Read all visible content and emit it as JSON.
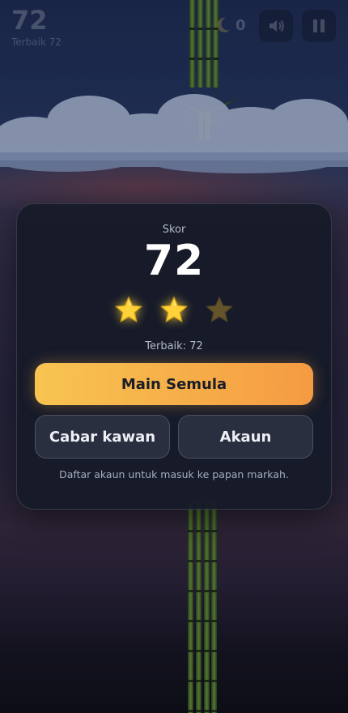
{
  "hud": {
    "score": "72",
    "best": "Terbaik 72",
    "moon_count": "0",
    "icons": [
      "moon-icon",
      "sound-icon",
      "pause-icon"
    ]
  },
  "result": {
    "score_label": "Skor",
    "score_value": "72",
    "stars_earned": 2,
    "stars_total": 3,
    "best_line": "Terbaik: 72",
    "replay_label": "Main Semula",
    "challenge_label": "Cabar kawan",
    "account_label": "Akaun",
    "hint": "Daftar akaun untuk masuk ke papan markah."
  },
  "colors": {
    "primary_gradient_start": "#f8c451",
    "primary_gradient_end": "#f59b42",
    "star_on": "#ffd23a",
    "modal_bg": "#161a28"
  }
}
